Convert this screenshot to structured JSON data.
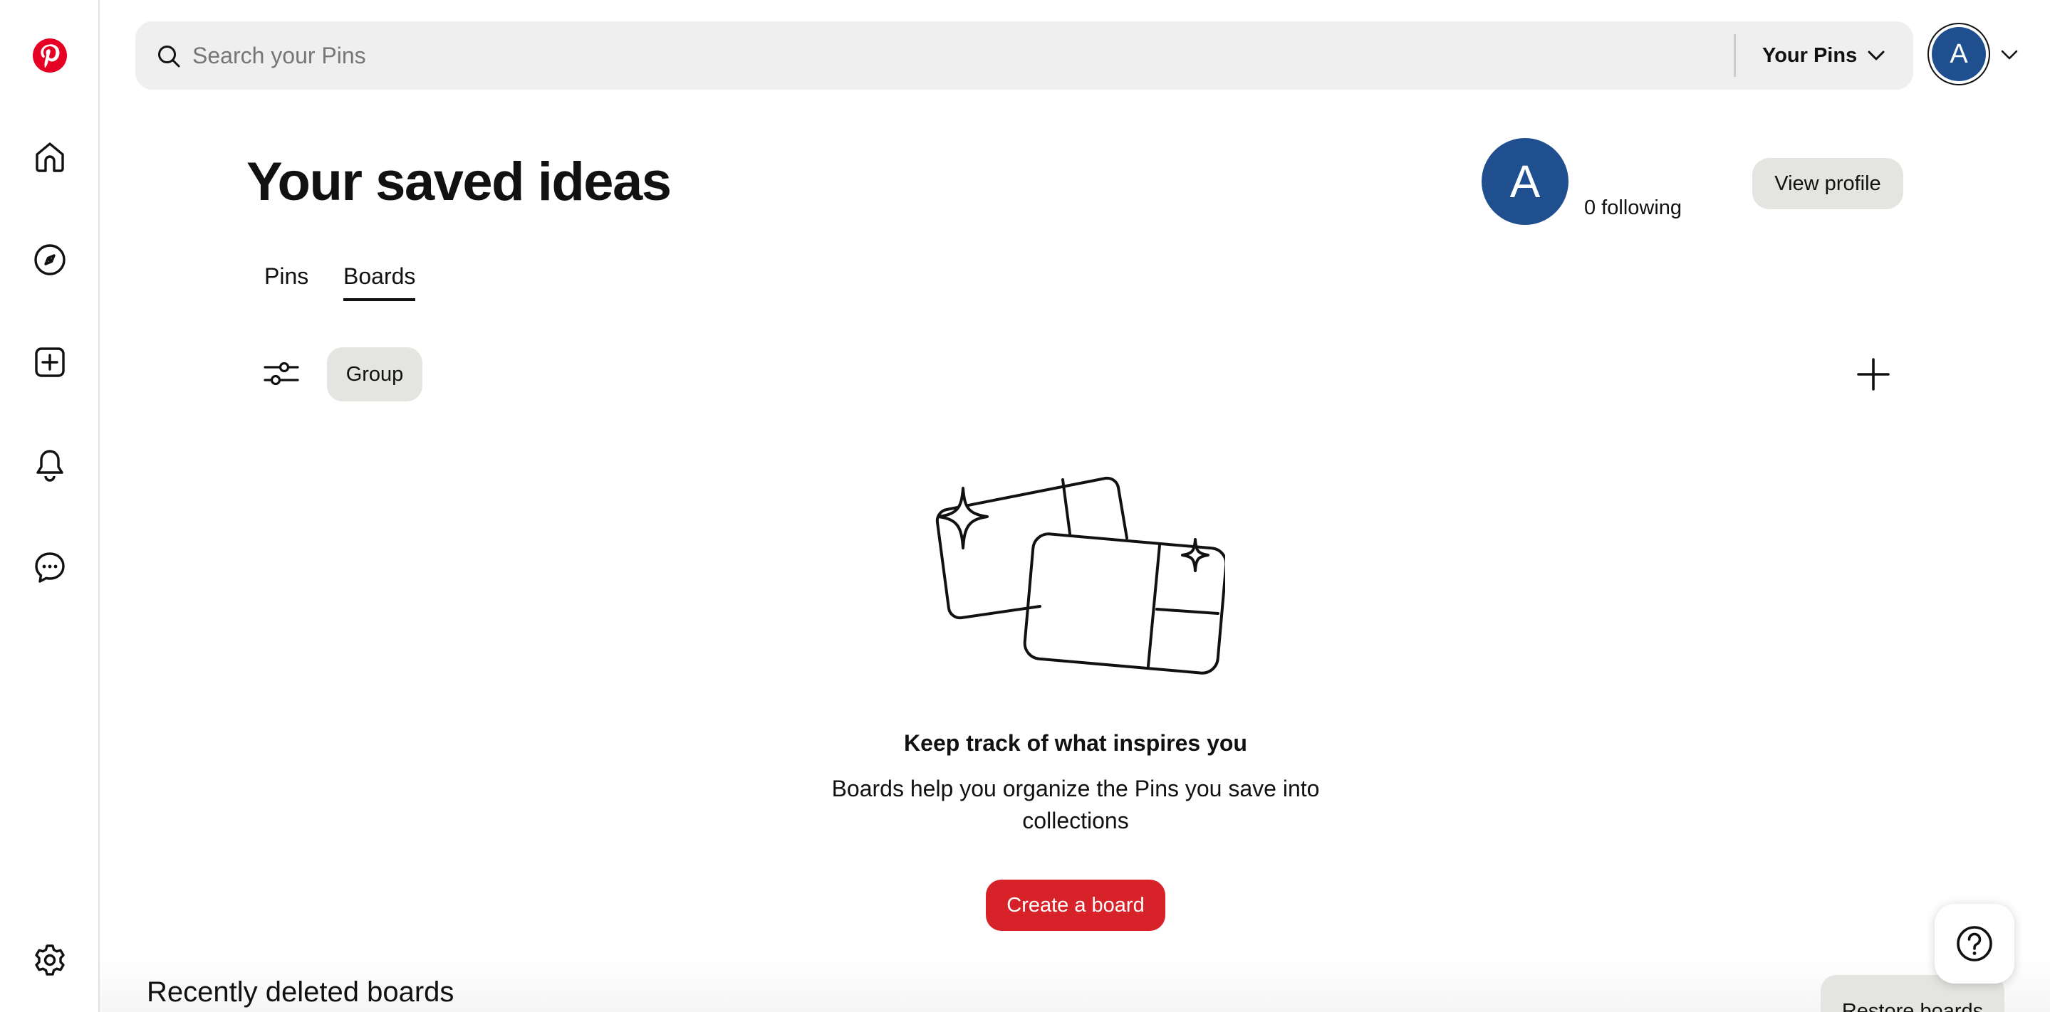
{
  "sidebar": {
    "logo_icon": "pinterest-logo",
    "items": [
      {
        "name": "home",
        "icon": "home-icon"
      },
      {
        "name": "explore",
        "icon": "compass-icon"
      },
      {
        "name": "create",
        "icon": "plus-square-icon"
      },
      {
        "name": "updates",
        "icon": "bell-icon"
      },
      {
        "name": "messages",
        "icon": "chat-bubble-icon"
      }
    ],
    "settings_icon": "gear-icon"
  },
  "topbar": {
    "search_placeholder": "Search your Pins",
    "search_value": "",
    "scope_label": "Your Pins",
    "account_initial": "A"
  },
  "header": {
    "title": "Your saved ideas",
    "profile_initial": "A",
    "following": "0 following",
    "view_profile_label": "View profile"
  },
  "tabs": [
    {
      "label": "Pins",
      "active": false
    },
    {
      "label": "Boards",
      "active": true
    }
  ],
  "toolbar": {
    "group_label": "Group"
  },
  "empty_state": {
    "heading": "Keep track of what inspires you",
    "body": "Boards help you organize the Pins you save into collections",
    "cta_label": "Create a board"
  },
  "recently_deleted": {
    "title": "Recently deleted boards",
    "restore_label": "Restore boards"
  },
  "colors": {
    "brand_red": "#e60023",
    "avatar_blue": "#1f4f8f",
    "button_gray": "#e4e4e1"
  }
}
